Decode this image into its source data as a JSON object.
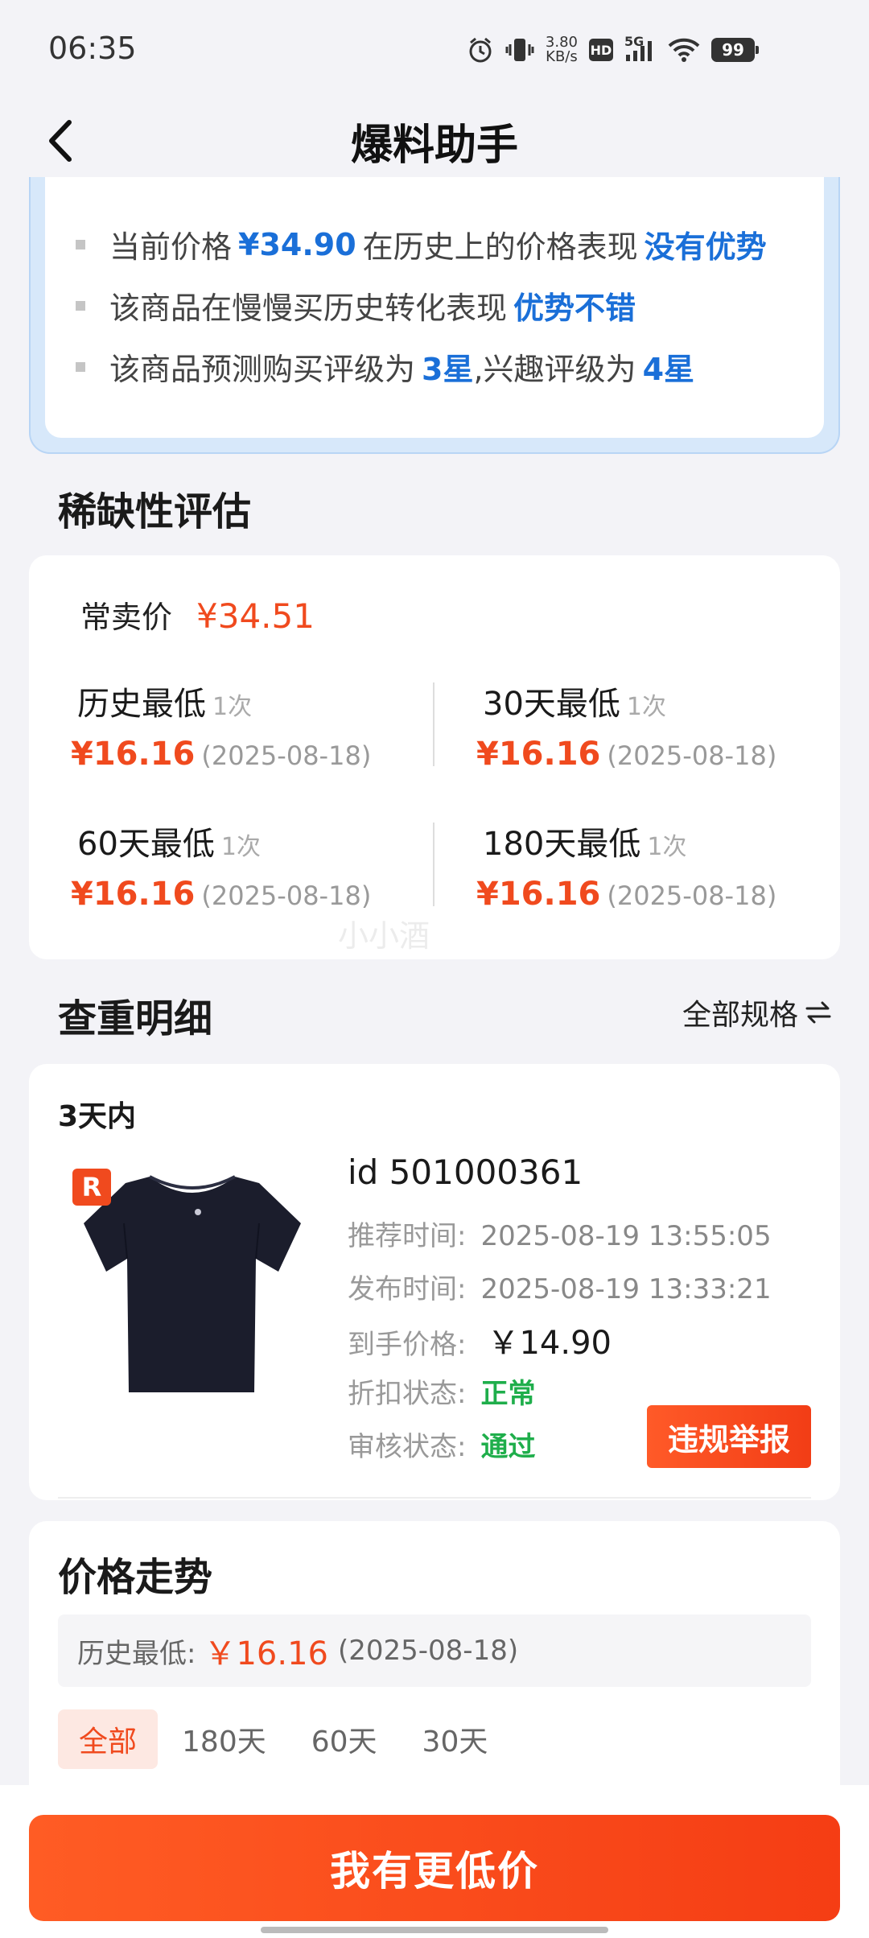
{
  "status_bar": {
    "time": "06:35",
    "net_speed_value": "3.80",
    "net_speed_unit": "KB/s",
    "hd": "HD",
    "signal": "5G",
    "battery": "99",
    "icons": [
      "alarm-icon",
      "vibrate-icon",
      "wifi-icon",
      "signal-icon",
      "battery-icon"
    ]
  },
  "nav": {
    "title": "爆料助手"
  },
  "analysis": {
    "rows": [
      {
        "pre": "当前价格",
        "value": "¥34.90",
        "mid": "在历史上的价格表现",
        "value2": "没有优势"
      },
      {
        "pre": "该商品在慢慢买历史转化表现",
        "value": "优势不错"
      },
      {
        "pre": "该商品预测购买评级为",
        "value": "3星",
        "mid": ",兴趣评级为",
        "value2": "4星"
      }
    ]
  },
  "scarcity": {
    "title": "稀缺性评估",
    "regular_label": "常卖价",
    "regular_price": "¥34.51",
    "stats": [
      {
        "title": "历史最低",
        "count": "1次",
        "price": "¥16.16",
        "date": "(2025-08-18)"
      },
      {
        "title": "30天最低",
        "count": "1次",
        "price": "¥16.16",
        "date": "(2025-08-18)"
      },
      {
        "title": "60天最低",
        "count": "1次",
        "price": "¥16.16",
        "date": "(2025-08-18)"
      },
      {
        "title": "180天最低",
        "count": "1次",
        "price": "¥16.16",
        "date": "(2025-08-18)"
      }
    ],
    "watermark": "小小酒"
  },
  "duplicate": {
    "title": "查重明细",
    "spec_link": "全部规格",
    "period": "3天内",
    "badge": "R",
    "item_id": "id 501000361",
    "recommend_label": "推荐时间:",
    "recommend_time": "2025-08-19 13:55:05",
    "publish_label": "发布时间:",
    "publish_time": "2025-08-19 13:33:21",
    "price_label": "到手价格:",
    "price": "￥14.90",
    "discount_label": "折扣状态:",
    "discount_status": "正常",
    "review_label": "审核状态:",
    "review_status": "通过",
    "report_button": "违规举报"
  },
  "trend": {
    "title": "价格走势",
    "lowest_label": "历史最低:",
    "lowest_price": "￥16.16",
    "lowest_date": "(2025-08-18)",
    "tabs": [
      "全部",
      "180天",
      "60天",
      "30天"
    ]
  },
  "cta": {
    "label": "我有更低价"
  },
  "colors": {
    "accent_red": "#f04a1e",
    "accent_blue": "#1a6fd8",
    "status_green": "#1fae4b"
  }
}
